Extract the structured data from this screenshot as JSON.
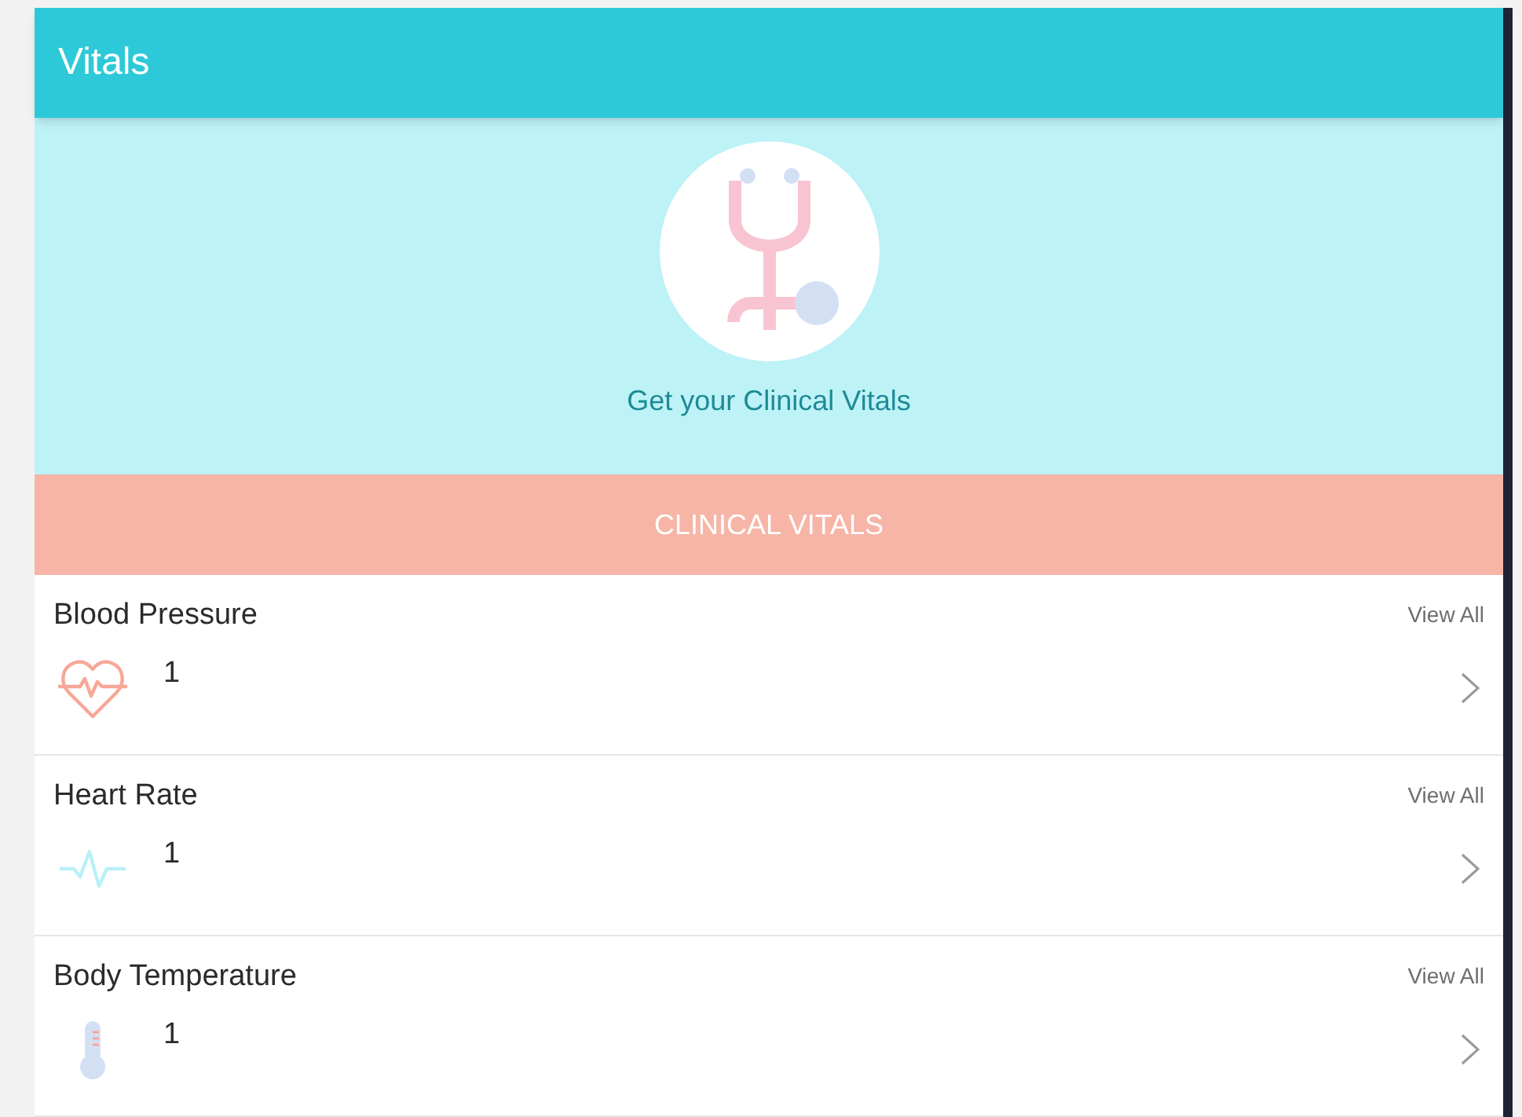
{
  "header": {
    "title": "Vitals"
  },
  "hero": {
    "caption": "Get your Clinical Vitals"
  },
  "section": {
    "title": "CLINICAL VITALS"
  },
  "vitals": [
    {
      "name": "Blood Pressure",
      "kind": "heart",
      "count": "1",
      "link": "View All"
    },
    {
      "name": "Heart Rate",
      "kind": "pulse",
      "count": "1",
      "link": "View All"
    },
    {
      "name": "Body Temperature",
      "kind": "thermometer",
      "count": "1",
      "link": "View All"
    }
  ]
}
